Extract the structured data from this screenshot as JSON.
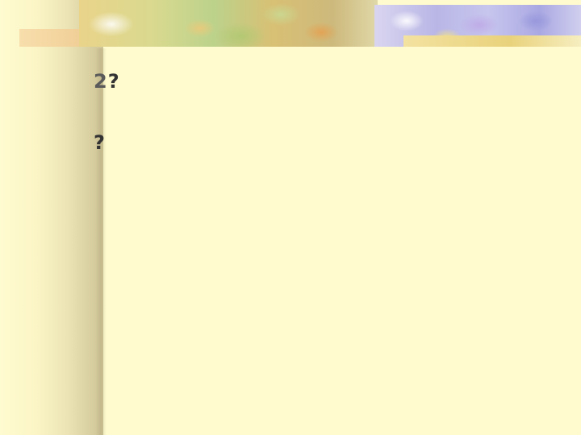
{
  "title": {
    "marker": "",
    "number": "2",
    "line1": "",
    "qmark1": "?",
    "line2": "",
    "line3": "",
    "qmark2": "?"
  },
  "body": {
    "lead": "",
    "s1_hl": "",
    "s2": "",
    "s3_hl": "",
    "s4": "",
    "s5_hl": "",
    "s6": "",
    "s7_hl": "",
    "s8": "",
    "s9_hl": ""
  },
  "colors": {
    "background": "#fffbcf",
    "text": "#5a5a5a",
    "highlight": "#c0302a"
  }
}
